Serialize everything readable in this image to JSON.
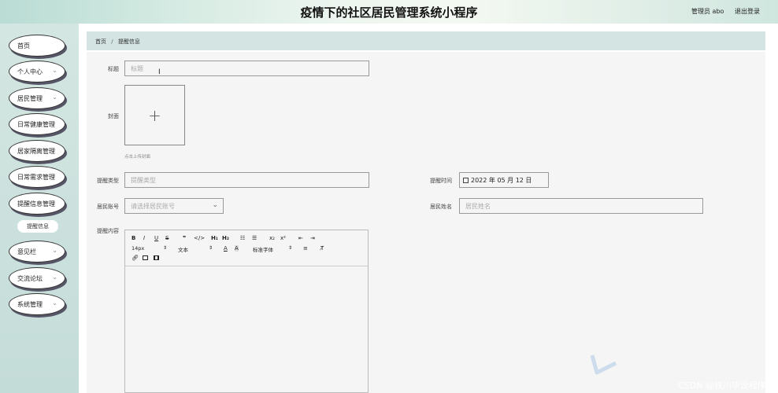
{
  "header": {
    "title": "疫情下的社区居民管理系统小程序",
    "admin": "管理员 abo",
    "logout": "退出登录"
  },
  "sidebar": {
    "items": [
      {
        "label": "首页"
      },
      {
        "label": "个人中心"
      },
      {
        "label": "居民管理"
      },
      {
        "label": "日常健康管理"
      },
      {
        "label": "居家隔离管理"
      },
      {
        "label": "日常需求管理"
      },
      {
        "label": "提醒信息管理"
      },
      {
        "label": "意见栏"
      },
      {
        "label": "交流论坛"
      },
      {
        "label": "系统管理"
      }
    ],
    "sub": "提醒信息"
  },
  "breadcrumb": {
    "home": "首页",
    "sep": "/",
    "current": "提醒信息"
  },
  "form": {
    "title_label": "标题",
    "title_placeholder": "标题",
    "cover_label": "封面",
    "cover_plus": "+",
    "cover_hint": "点击上传封面",
    "type_label": "提醒类型",
    "type_placeholder": "提醒类型",
    "time_label": "提醒时间",
    "time_value": "2022 年 05 月 12 日",
    "account_label": "居民账号",
    "account_placeholder": "请选择居民账号",
    "name_label": "居民姓名",
    "name_placeholder": "居民姓名",
    "content_label": "提醒内容"
  },
  "editor": {
    "font_size": "14px",
    "block": "文本",
    "font_family": "标准字体"
  },
  "watermark": "CSDN @铁川毕设程序"
}
